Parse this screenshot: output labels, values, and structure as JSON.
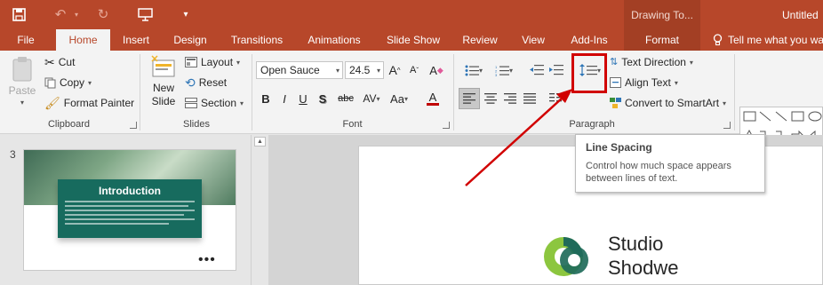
{
  "colors": {
    "accent": "#b7472a",
    "highlight": "#d10000",
    "slide_card": "#176b5e"
  },
  "quick_access": {
    "save_icon": "save-icon",
    "undo_icon": "undo-icon",
    "redo_icon": "redo-icon",
    "present_icon": "present-from-beginning-icon",
    "customize_icon": "customize-qat-icon"
  },
  "contextual_tab_title": "Drawing To...",
  "document_title": "Untitled",
  "tabs": [
    "File",
    "Home",
    "Insert",
    "Design",
    "Transitions",
    "Animations",
    "Slide Show",
    "Review",
    "View",
    "Add-Ins",
    "Format"
  ],
  "tell_me": "Tell me what you wa",
  "clipboard": {
    "paste": "Paste",
    "cut": "Cut",
    "copy": "Copy",
    "format_painter": "Format Painter",
    "label": "Clipboard"
  },
  "slides": {
    "new_slide_1": "New",
    "new_slide_2": "Slide",
    "layout": "Layout",
    "reset": "Reset",
    "section": "Section",
    "label": "Slides"
  },
  "font": {
    "name": "Open Sauce",
    "size": "24.5",
    "grow": "A",
    "shrink": "A",
    "clear": "A",
    "bold": "B",
    "italic": "I",
    "underline": "U",
    "shadow": "S",
    "strike": "abc",
    "spacing": "AV",
    "case": "Aa",
    "color": "A",
    "label": "Font"
  },
  "paragraph": {
    "text_direction": "Text Direction",
    "align_text": "Align Text",
    "smartart": "Convert to SmartArt",
    "label": "Paragraph"
  },
  "tooltip": {
    "title": "Line Spacing",
    "description_1": "Control how much space appears",
    "description_2": "between lines of text."
  },
  "thumbnail": {
    "number": "3",
    "title": "Introduction",
    "dots": "•••"
  },
  "slide": {
    "logo_line1": "Studio",
    "logo_line2": "Shodwe"
  }
}
